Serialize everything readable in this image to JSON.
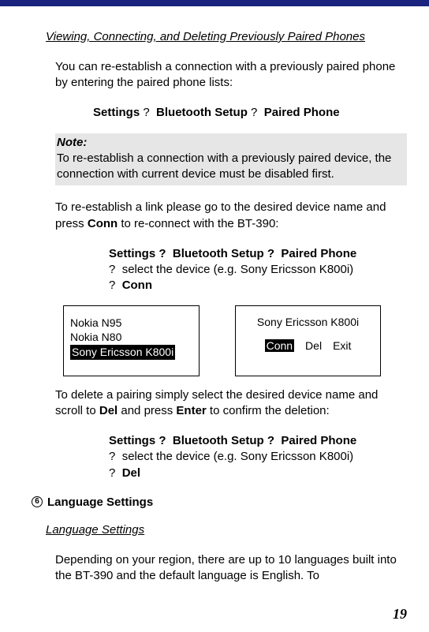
{
  "section_title": "Viewing, Connecting, and Deleting Previously Paired Phones",
  "intro": "You can re-establish a connection with a previously paired phone by entering the paired phone lists:",
  "nav1": {
    "a": "Settings",
    "b": "Bluetooth Setup",
    "c": "Paired Phone"
  },
  "note": {
    "label": "Note:",
    "text": "To re-establish a connection with a previously paired device, the connection with current device must be disabled first."
  },
  "reestablish_intro": "To re-establish a link please go to the desired device name and press ",
  "reestablish_bold": "Conn",
  "reestablish_after": " to re-connect with the BT-390:",
  "steps_conn": {
    "line1a": "Settings ?",
    "line1b": "Bluetooth Setup ?",
    "line1c": "Paired Phone",
    "line2": "select the device (e.g. Sony Ericsson K800i)",
    "line3": "Conn"
  },
  "left_screen": {
    "row1": "Nokia N95",
    "row2": "Nokia N80",
    "row3": "Sony Ericsson K800i"
  },
  "right_screen": {
    "title": "Sony Ericsson K800i",
    "btn1": "Conn",
    "btn2": "Del",
    "btn3": "Exit"
  },
  "delete_intro_a": "To delete a pairing simply select the desired device name and scroll to ",
  "delete_bold1": "Del",
  "delete_intro_b": " and press ",
  "delete_bold2": "Enter",
  "delete_intro_c": " to confirm the deletion:",
  "steps_del": {
    "line1a": "Settings ?",
    "line1b": "Bluetooth Setup ?",
    "line1c": "Paired Phone",
    "line2": "select the device (e.g. Sony Ericsson K800i)",
    "line3": "Del"
  },
  "bullet_num": "6",
  "bullet_heading": "Language Settings",
  "lang_section_title": "Language Settings",
  "lang_para": "Depending on your region, there are up to 10 languages built into the BT-390 and the default language is English. To",
  "page_number": "19",
  "q": "?"
}
